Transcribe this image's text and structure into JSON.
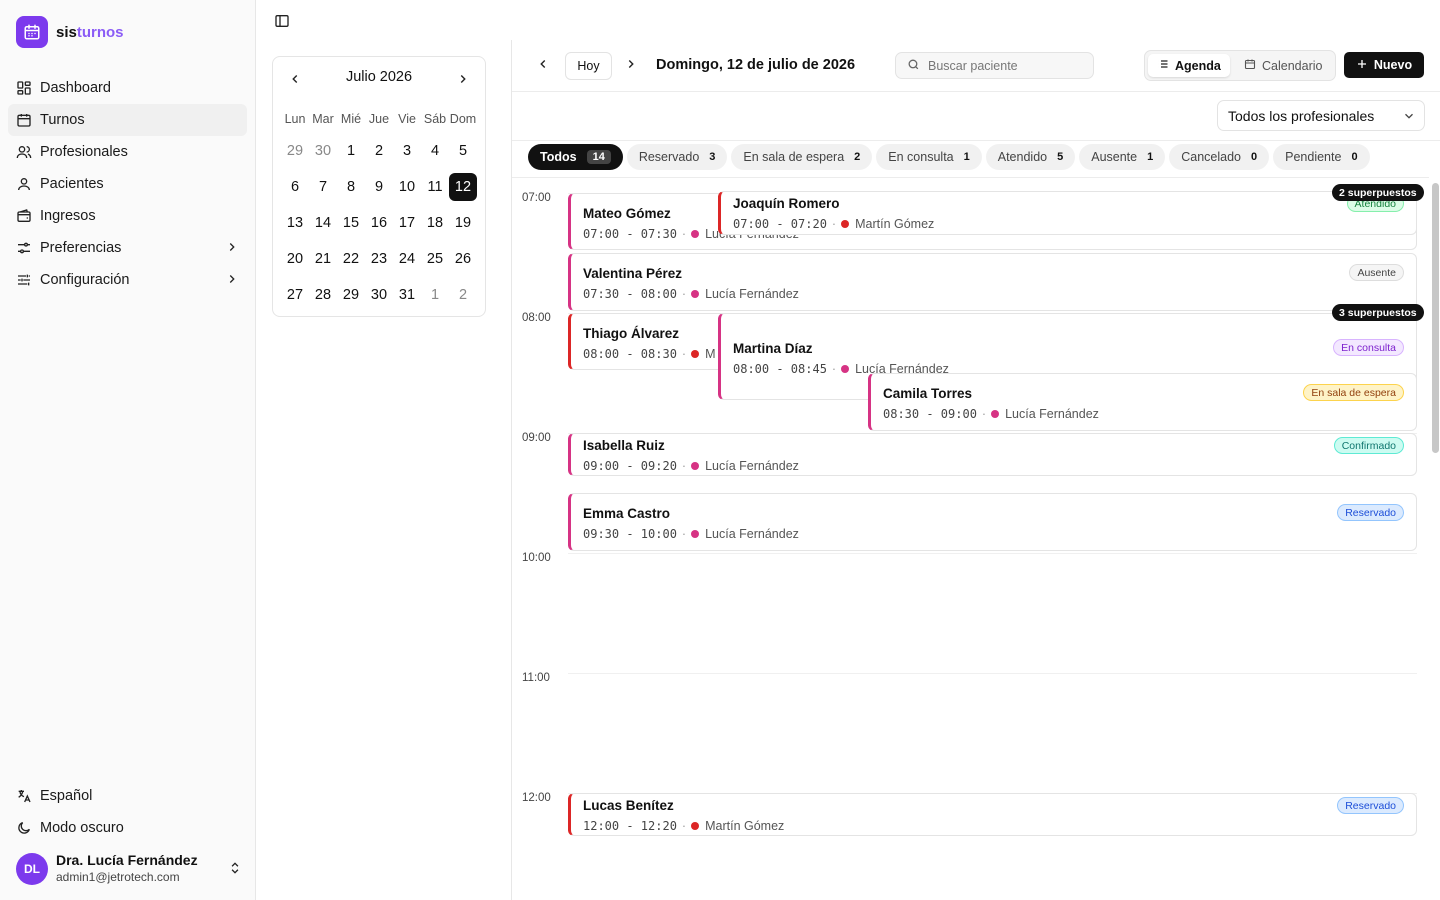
{
  "app": {
    "brand_a": "sis",
    "brand_b": "turnos"
  },
  "sidebar": {
    "items": [
      {
        "label": "Dashboard",
        "icon": "dashboard-icon"
      },
      {
        "label": "Turnos",
        "icon": "calendar-icon"
      },
      {
        "label": "Profesionales",
        "icon": "users-icon"
      },
      {
        "label": "Pacientes",
        "icon": "user-icon"
      },
      {
        "label": "Ingresos",
        "icon": "wallet-icon"
      },
      {
        "label": "Preferencias",
        "icon": "sliders-icon"
      },
      {
        "label": "Configuración",
        "icon": "settings-sliders-icon"
      }
    ],
    "language": "Español",
    "dark_mode": "Modo oscuro",
    "user": {
      "initials": "DL",
      "name": "Dra. Lucía Fernández",
      "email": "admin1@jetrotech.com"
    }
  },
  "mini_calendar": {
    "month": "Julio 2026",
    "weekdays": [
      "Lun",
      "Mar",
      "Mié",
      "Jue",
      "Vie",
      "Sáb",
      "Dom"
    ],
    "weeks": [
      [
        "29",
        "30",
        "1",
        "2",
        "3",
        "4",
        "5"
      ],
      [
        "6",
        "7",
        "8",
        "9",
        "10",
        "11",
        "12"
      ],
      [
        "13",
        "14",
        "15",
        "16",
        "17",
        "18",
        "19"
      ],
      [
        "20",
        "21",
        "22",
        "23",
        "24",
        "25",
        "26"
      ],
      [
        "27",
        "28",
        "29",
        "30",
        "31",
        "1",
        "2"
      ]
    ],
    "selected": "12"
  },
  "toolbar": {
    "today": "Hoy",
    "date": "Domingo, 12 de julio de 2026",
    "search_placeholder": "Buscar paciente",
    "view_agenda": "Agenda",
    "view_calendar": "Calendario",
    "new_button": "Nuevo"
  },
  "professional_select": "Todos los profesionales",
  "filters": [
    {
      "label": "Todos",
      "count": "14"
    },
    {
      "label": "Reservado",
      "count": "3"
    },
    {
      "label": "En sala de espera",
      "count": "2"
    },
    {
      "label": "En consulta",
      "count": "1"
    },
    {
      "label": "Atendido",
      "count": "5"
    },
    {
      "label": "Ausente",
      "count": "1"
    },
    {
      "label": "Cancelado",
      "count": "0"
    },
    {
      "label": "Pendiente",
      "count": "0"
    }
  ],
  "hours": [
    "07:00",
    "08:00",
    "09:00",
    "10:00",
    "11:00",
    "12:00"
  ],
  "appointments": [
    {
      "name": "Mateo Gómez",
      "time": "07:00 - 07:30",
      "professional": "Lucía Fernández",
      "status": "",
      "dot": "#d63384"
    },
    {
      "name": "Joaquín Romero",
      "time": "07:00 - 07:20",
      "professional": "Martín Gómez",
      "status": "Atendido",
      "dot": "#dc2626"
    },
    {
      "name": "Valentina Pérez",
      "time": "07:30 - 08:00",
      "professional": "Lucía Fernández",
      "status": "Ausente",
      "dot": "#d63384"
    },
    {
      "name": "Thiago Álvarez",
      "time": "08:00 - 08:30",
      "professional": "M",
      "status": "",
      "dot": "#dc2626"
    },
    {
      "name": "Martina Díaz",
      "time": "08:00 - 08:45",
      "professional": "Lucía Fernández",
      "status": "En consulta",
      "dot": "#d63384"
    },
    {
      "name": "Camila Torres",
      "time": "08:30 - 09:00",
      "professional": "Lucía Fernández",
      "status": "En sala de espera",
      "dot": "#d63384"
    },
    {
      "name": "Isabella Ruiz",
      "time": "09:00 - 09:20",
      "professional": "Lucía Fernández",
      "status": "Confirmado",
      "dot": "#d63384"
    },
    {
      "name": "Emma Castro",
      "time": "09:30 - 10:00",
      "professional": "Lucía Fernández",
      "status": "Reservado",
      "dot": "#d63384"
    },
    {
      "name": "Lucas Benítez",
      "time": "12:00 - 12:20",
      "professional": "Martín Gómez",
      "status": "Reservado",
      "dot": "#dc2626"
    }
  ],
  "overlaps": {
    "first": "2 superpuestos",
    "second": "3 superpuestos"
  },
  "colors": {
    "brand": "#7c3aed",
    "lucia": "#d63384",
    "martin": "#dc2626"
  }
}
